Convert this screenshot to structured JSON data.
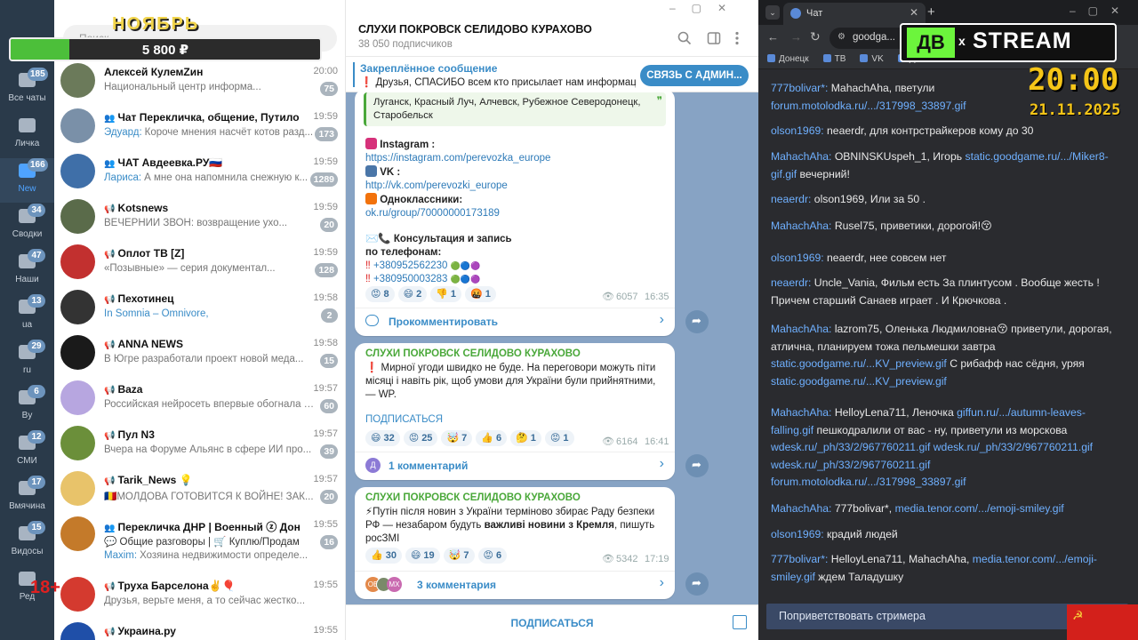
{
  "overlay": {
    "month": "НОЯБРЬ",
    "amount": "5 800 ₽",
    "search_stub": "Поиск",
    "age": "18+",
    "clock_time": "20:00",
    "clock_date": "21.11.2025",
    "stream_logo_left": "ДВ",
    "stream_logo_right": "STREAM",
    "x": "x"
  },
  "folders": [
    {
      "label": "Все чаты",
      "badge": "185",
      "active": false
    },
    {
      "label": "Личка",
      "badge": "",
      "active": false
    },
    {
      "label": "New",
      "badge": "166",
      "active": true
    },
    {
      "label": "Сводки",
      "badge": "34",
      "active": false
    },
    {
      "label": "Наши",
      "badge": "47",
      "active": false
    },
    {
      "label": "ua",
      "badge": "13",
      "active": false
    },
    {
      "label": "ru",
      "badge": "29",
      "active": false
    },
    {
      "label": "By",
      "badge": "6",
      "active": false
    },
    {
      "label": "СМИ",
      "badge": "12",
      "active": false
    },
    {
      "label": "Вмячина",
      "badge": "17",
      "active": false
    },
    {
      "label": "Видосы",
      "badge": "15",
      "active": false
    },
    {
      "label": "Ред",
      "badge": "",
      "active": false
    }
  ],
  "chats": [
    {
      "name": "Алексей КулемZин",
      "prefix": "",
      "time": "20:00",
      "sender": "",
      "preview": "Национальный центр информа...",
      "badge": "75",
      "color": "#6b7a5a"
    },
    {
      "name": "Чат Перекличка, общение, Путиловка ...",
      "prefix": "👥",
      "time": "19:59",
      "sender": "Эдуард:",
      "preview": "Короче мнения насчёт котов разд...",
      "badge": "173",
      "color": "#7a90a8"
    },
    {
      "name": "ЧАТ Авдеевка.РУ🇷🇺",
      "prefix": "👥",
      "time": "19:59",
      "sender": "Лариса:",
      "preview": "А мне она напомнила снежную к...",
      "badge": "1289",
      "color": "#3f6fa8"
    },
    {
      "name": "Kotsnews",
      "prefix": "📢",
      "time": "19:59",
      "sender": "",
      "preview": "ВЕЧЕРНИЙ ЗВОН: возвращение ухо...",
      "badge": "20",
      "color": "#5a6b4a"
    },
    {
      "name": "Оплот ТВ [Z]",
      "prefix": "📢",
      "time": "19:59",
      "sender": "",
      "preview": "«Позывные» — серия документал...",
      "badge": "128",
      "color": "#c2302f"
    },
    {
      "name": "Пехотинец",
      "prefix": "📢",
      "time": "19:58",
      "sender": "In Somnia – Omnivore,",
      "preview": "",
      "badge": "2",
      "color": "#333333"
    },
    {
      "name": "ANNA NEWS",
      "prefix": "📢",
      "time": "19:58",
      "sender": "",
      "preview": "В Югре разработали проект новой меда...",
      "badge": "15",
      "color": "#1a1a1a"
    },
    {
      "name": "Baza",
      "prefix": "📢",
      "time": "19:57",
      "sender": "",
      "preview": "Российская нейросеть впервые обогнала за...",
      "badge": "60",
      "color": "#b7a6e0"
    },
    {
      "name": "Пул N3",
      "prefix": "📢",
      "time": "19:57",
      "sender": "",
      "preview": "Вчера на Форуме Альянс в сфере ИИ про...",
      "badge": "39",
      "color": "#6b8f3a"
    },
    {
      "name": "Tarik_News 💡",
      "prefix": "📢",
      "time": "19:57",
      "sender": "",
      "preview": "🇷🇴МОЛДОВА ГОТОВИТСЯ К ВОЙНЕ! ЗАК...",
      "badge": "20",
      "color": "#e8c36a"
    },
    {
      "name": "Перекличка ДНР | Военный ⓩ Донецк",
      "prefix": "👥",
      "time": "19:55",
      "sender": "Maxim:",
      "preview": "Хозяина недвижимости определе...",
      "badge": "16",
      "color": "#c47a2a",
      "extra": "💬 Общие разговоры | 🛒 Куплю/Продам"
    },
    {
      "name": "Труха Барселона✌️🎈",
      "prefix": "📢",
      "time": "19:55",
      "sender": "",
      "preview": "Друзья, верьте меня, а то сейчас жестко...",
      "badge": "",
      "color": "#d43a2f"
    },
    {
      "name": "Украина.ру",
      "prefix": "📢",
      "time": "19:55",
      "sender": "",
      "preview": "",
      "badge": "",
      "color": "#1f4fa8"
    }
  ],
  "channel": {
    "title": "СЛУХИ ПОКРОВСК СЕЛИДОВО КУРАХОВО",
    "subs": "38 050 подписчиков",
    "pinned_label": "Закреплённое сообщение",
    "pinned_text": "❗ Друзья, СПАСИБО всем кто присылает нам информац...",
    "pinned_button": "СВЯЗЬ С АДМИН...",
    "subscribe": "ПОДПИСАТЬСЯ"
  },
  "post1": {
    "quote": "Луганск, Красный Луч, Алчевск, Рубежное Северодонецк, Старобельск",
    "ig_label": "Instagram :",
    "ig_link": "https://instagram.com/perevozka_europe",
    "vk_label": "VK :",
    "vk_link": "http://vk.com/perevozki_europe",
    "ok_label": "Одноклассники:",
    "ok_link": "ok.ru/group/70000000173189",
    "consult": "Консультация и запись по телефонам:",
    "phone1": "+380952562230",
    "phone2": "+380950003283",
    "reactions": [
      {
        "e": "😡",
        "n": "8"
      },
      {
        "e": "😄",
        "n": "2"
      },
      {
        "e": "👎",
        "n": "1"
      },
      {
        "e": "🤬",
        "n": "1"
      }
    ],
    "views": "6057",
    "time": "16:35",
    "comment": "Прокомментировать"
  },
  "post2": {
    "author": "СЛУХИ ПОКРОВСК СЕЛИДОВО КУРАХОВО",
    "text": "❗ Мирної угоди швидко не буде. На переговори можуть піти місяці і навіть рік, щоб умови для України були прийнятними, — WP.",
    "subscribe": "ПОДПИСАТЬСЯ",
    "reactions": [
      {
        "e": "😄",
        "n": "32"
      },
      {
        "e": "😡",
        "n": "25"
      },
      {
        "e": "🤯",
        "n": "7"
      },
      {
        "e": "👍",
        "n": "6"
      },
      {
        "e": "🤔",
        "n": "1"
      },
      {
        "e": "😡",
        "n": "1"
      }
    ],
    "views": "6164",
    "time": "16:41",
    "comment": "1 комментарий",
    "avatar_letter": "Д"
  },
  "post3": {
    "author": "СЛУХИ ПОКРОВСК СЕЛИДОВО КУРАХОВО",
    "text_a": "⚡Путін після новин з України терміново збирає Раду безпеки РФ — незабаром будуть",
    "text_b": "важливі новини з Кремля",
    "text_c": ", пишуть росЗМІ",
    "reactions": [
      {
        "e": "👍",
        "n": "30"
      },
      {
        "e": "😄",
        "n": "19"
      },
      {
        "e": "🤯",
        "n": "7"
      },
      {
        "e": "😡",
        "n": "6"
      }
    ],
    "views": "5342",
    "time": "17:19",
    "comment": "3 комментария",
    "avatar_letters": [
      "ОВ",
      "МХ"
    ]
  },
  "browser": {
    "tab_title": "Чат",
    "url": "goodga...",
    "bookmarks": [
      "Донецк",
      "ТВ",
      "VK",
      "Д"
    ],
    "greet": "Поприветствовать стримера"
  },
  "messages": [
    {
      "user": "777bolivar*:",
      "parts": [
        {
          "t": " MahachAha, пветули "
        },
        {
          "l": "forum.motolodka.ru/.../317998_33897.gif"
        }
      ]
    },
    {
      "user": "olson1969:",
      "parts": [
        {
          "t": " neaerdr, для контрстрайкеров кому до 30"
        }
      ]
    },
    {
      "user": "MahachAha:",
      "parts": [
        {
          "t": " OBNINSKUspeh_1, Игорь "
        },
        {
          "l": "static.goodgame.ru/.../Miker8-gif.gif"
        },
        {
          "t": " вечерний!"
        }
      ]
    },
    {
      "user": "neaerdr:",
      "parts": [
        {
          "t": " olson1969, Или за 50 ."
        }
      ]
    },
    {
      "user": "MahachAha:",
      "parts": [
        {
          "t": " Rusel75, приветики, дорогой!😚"
        }
      ]
    },
    {
      "user": "olson1969:",
      "parts": [
        {
          "t": " neaerdr, нее совсем нет"
        }
      ]
    },
    {
      "user": "neaerdr:",
      "parts": [
        {
          "t": " Uncle_Vania, Фильм есть За плинтусом . Вообще жесть ! Причем старший Санаев играет . И Крючкова ."
        }
      ]
    },
    {
      "user": "MahachAha:",
      "parts": [
        {
          "t": " lazrom75, Оленька Людмиловна😚 приветули, дорогая, атлична, планируем тожа пельмешки завтра "
        },
        {
          "l": "static.goodgame.ru/...KV_preview.gif"
        },
        {
          "t": " С рибафф нас сёдня, уряя "
        },
        {
          "l": "static.goodgame.ru/...KV_preview.gif"
        }
      ]
    },
    {
      "user": "MahachAha:",
      "parts": [
        {
          "t": " HelloyLena711, Леночка "
        },
        {
          "l": "giffun.ru/.../autumn-leaves-falling.gif"
        },
        {
          "t": " пешкодралили от вас - ну, приветули из морскова "
        },
        {
          "l": "wdesk.ru/_ph/33/2/967760211.gif"
        },
        {
          "t": " "
        },
        {
          "l": "wdesk.ru/_ph/33/2/967760211.gif"
        },
        {
          "t": " "
        },
        {
          "l": "wdesk.ru/_ph/33/2/967760211.gif"
        },
        {
          "t": " "
        },
        {
          "l": "forum.motolodka.ru/.../317998_33897.gif"
        }
      ]
    },
    {
      "user": "MahachAha:",
      "parts": [
        {
          "t": " 777bolivar*, "
        },
        {
          "l": "media.tenor.com/.../emoji-smiley.gif"
        }
      ]
    },
    {
      "user": "olson1969:",
      "parts": [
        {
          "t": " крадий людей"
        }
      ]
    },
    {
      "user": "777bolivar*:",
      "parts": [
        {
          "t": " HelloyLena711, MahachAha, "
        },
        {
          "l": "media.tenor.com/.../emoji-smiley.gif"
        },
        {
          "t": " ждем Таладушку"
        }
      ]
    }
  ],
  "colors": {
    "accent": "#3a8cc7",
    "tg_sidebar": "#2a3a4a",
    "channel_bg": "#87a3c4",
    "chat_bg": "#2a2b2f",
    "link": "#6fb0ff",
    "green_author": "#4aa83a"
  }
}
